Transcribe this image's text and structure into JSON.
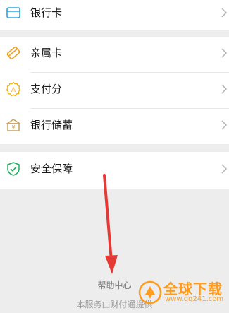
{
  "menu": {
    "bank_card": {
      "label": "银行卡",
      "icon": "bank-card-icon"
    },
    "family_card": {
      "label": "亲属卡",
      "icon": "family-card-icon"
    },
    "payment_score": {
      "label": "支付分",
      "icon": "payment-score-icon"
    },
    "bank_savings": {
      "label": "银行储蓄",
      "icon": "bank-savings-icon"
    },
    "security": {
      "label": "安全保障",
      "icon": "shield-icon"
    }
  },
  "footer": {
    "help": "帮助中心",
    "service_note": "本服务由财付通提供"
  },
  "watermark": {
    "title": "全球下载",
    "url": "www.qq241.com"
  },
  "colors": {
    "background": "#ededed",
    "card": "#ffffff",
    "bank_card_icon": "#2aa7e0",
    "family_card_icon": "#f0a020",
    "payment_score_icon": "#f2b21a",
    "bank_savings_icon": "#c9a060",
    "shield_icon": "#1aad5a",
    "arrow": "#e53935",
    "watermark": "#ff9a1a"
  }
}
